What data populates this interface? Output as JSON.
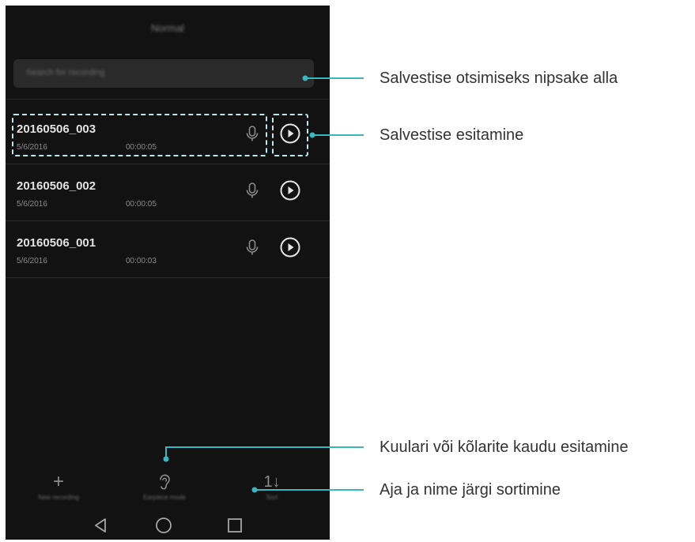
{
  "header": {
    "title": "Normal"
  },
  "search": {
    "placeholder": "Search for recording"
  },
  "recordings": [
    {
      "name": "20160506_003",
      "date": "5/6/2016",
      "duration": "00:00:05"
    },
    {
      "name": "20160506_002",
      "date": "5/6/2016",
      "duration": "00:00:05"
    },
    {
      "name": "20160506_001",
      "date": "5/6/2016",
      "duration": "00:00:03"
    }
  ],
  "toolbar": {
    "new_label": "New recording",
    "earpiece_label": "Earpiece mode",
    "sort_label": "Sort"
  },
  "annotations": {
    "search": "Salvestise otsimiseks nipsake alla",
    "play": "Salvestise esitamine",
    "earpiece": "Kuulari või kõlarite kaudu esitamine",
    "sort": "Aja ja nime järgi sortimine"
  },
  "colors": {
    "callout_line": "#3ab6be",
    "screen_bg": "#121212",
    "dash": "#bfe6ea"
  },
  "icons": [
    "microphone-icon",
    "play-icon",
    "plus-icon",
    "ear-icon",
    "sort-icon",
    "back-icon",
    "home-icon",
    "recents-icon"
  ]
}
